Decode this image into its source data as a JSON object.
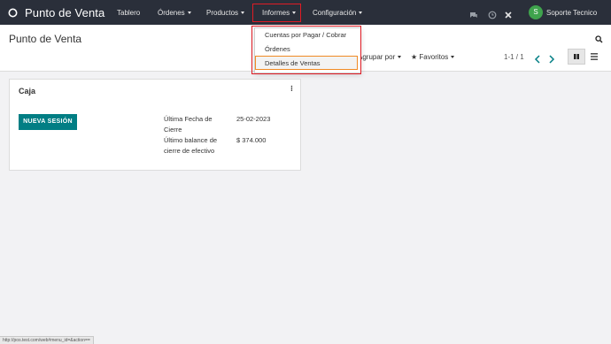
{
  "navbar": {
    "app_title": "Punto de Venta",
    "menu": [
      {
        "label": "Tablero"
      },
      {
        "label": "Órdenes"
      },
      {
        "label": "Productos"
      },
      {
        "label": "Informes"
      },
      {
        "label": "Configuración"
      }
    ],
    "user_initial": "S",
    "user_name": "Soporte Tecnico"
  },
  "control_panel": {
    "title": "Punto de Venta",
    "group_by": "Agrupar por",
    "favorites": "Favoritos",
    "pager": "1-1 / 1"
  },
  "dropdown": {
    "items": [
      {
        "label": "Cuentas por Pagar / Cobrar"
      },
      {
        "label": "Órdenes"
      },
      {
        "label": "Detalles de Ventas"
      }
    ]
  },
  "card": {
    "title": "Caja",
    "kebab": "⁝",
    "button": "NUEVA SESIÓN",
    "last_close_label": "Última Fecha de Cierre",
    "last_close_value": "25-02-2023",
    "last_balance_label": "Último balance de cierre de efectivo",
    "last_balance_value": "$ 374.000"
  },
  "status_bar": {
    "url": "http://pos.test.com/web#menu_id=&action=="
  },
  "colors": {
    "navbar": "#2a2f3a",
    "primary": "#017e84",
    "highlight_red": "#e01b24",
    "highlight_orange": "#f08a24"
  }
}
